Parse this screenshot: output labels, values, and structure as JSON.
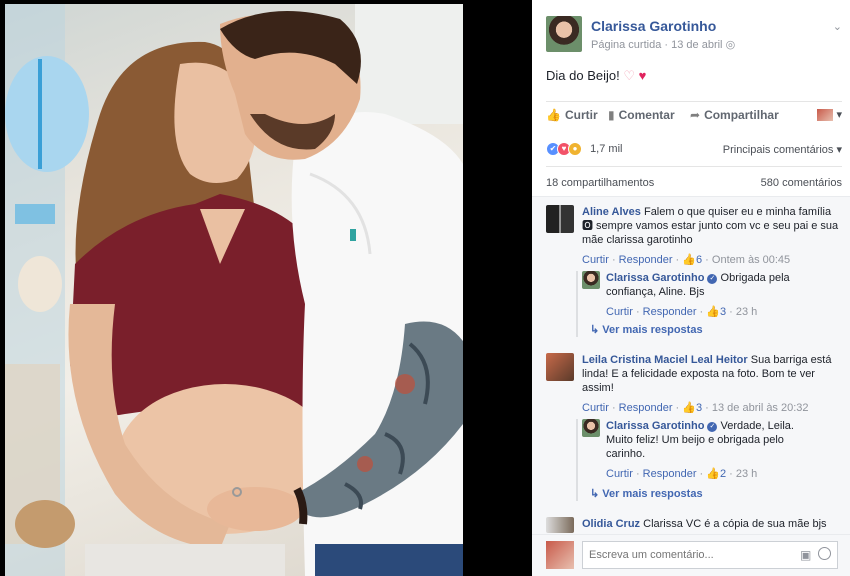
{
  "post": {
    "page_name": "Clarissa Garotinho",
    "page_type": "Página curtida",
    "separator": "·",
    "date": "13 de abril",
    "text": "Dia do Beijo!",
    "emoji_heart": "🤍",
    "emoji_kiss": "💋"
  },
  "actions": {
    "like": "Curtir",
    "comment": "Comentar",
    "share": "Compartilhar"
  },
  "reactions": {
    "count": "1,7 mil",
    "top_comments": "Principais comentários"
  },
  "stats": {
    "shares": "18 compartilhamentos",
    "comments": "580 comentários"
  },
  "comments": [
    {
      "author": "Aline Alves",
      "text": "Falem o que quiser eu e minha família 🅾 sempre vamos estar junto com vc e seu pai e sua mãe clarissa garotinho",
      "like": "Curtir",
      "reply": "Responder",
      "likes": "6",
      "time": "Ontem às 00:45"
    },
    {
      "author": "Clarissa Garotinho",
      "text": "Obrigada pela confiança, Aline. Bjs",
      "like": "Curtir",
      "reply": "Responder",
      "likes": "3",
      "time": "23 h"
    },
    {
      "author": "Leila Cristina Maciel Leal Heitor",
      "text": "Sua barriga está linda! E a felicidade exposta na foto. Bom te ver assim!",
      "like": "Curtir",
      "reply": "Responder",
      "likes": "3",
      "time": "13 de abril às 20:32"
    },
    {
      "author": "Clarissa Garotinho",
      "text": "Verdade, Leila. Muito feliz! Um beijo e obrigada pelo carinho.",
      "like": "Curtir",
      "reply": "Responder",
      "likes": "2",
      "time": "23 h"
    },
    {
      "author": "Olidia Cruz",
      "text": "Clarissa VC é a cópia de sua mãe bjs"
    }
  ],
  "more_replies": "Ver mais respostas",
  "composer": {
    "placeholder": "Escreva um comentário..."
  },
  "colors": {
    "link": "#365899",
    "action_blue": "#4267b2",
    "panel_bg": "#ffffff",
    "comments_bg": "#f6f7f9"
  }
}
